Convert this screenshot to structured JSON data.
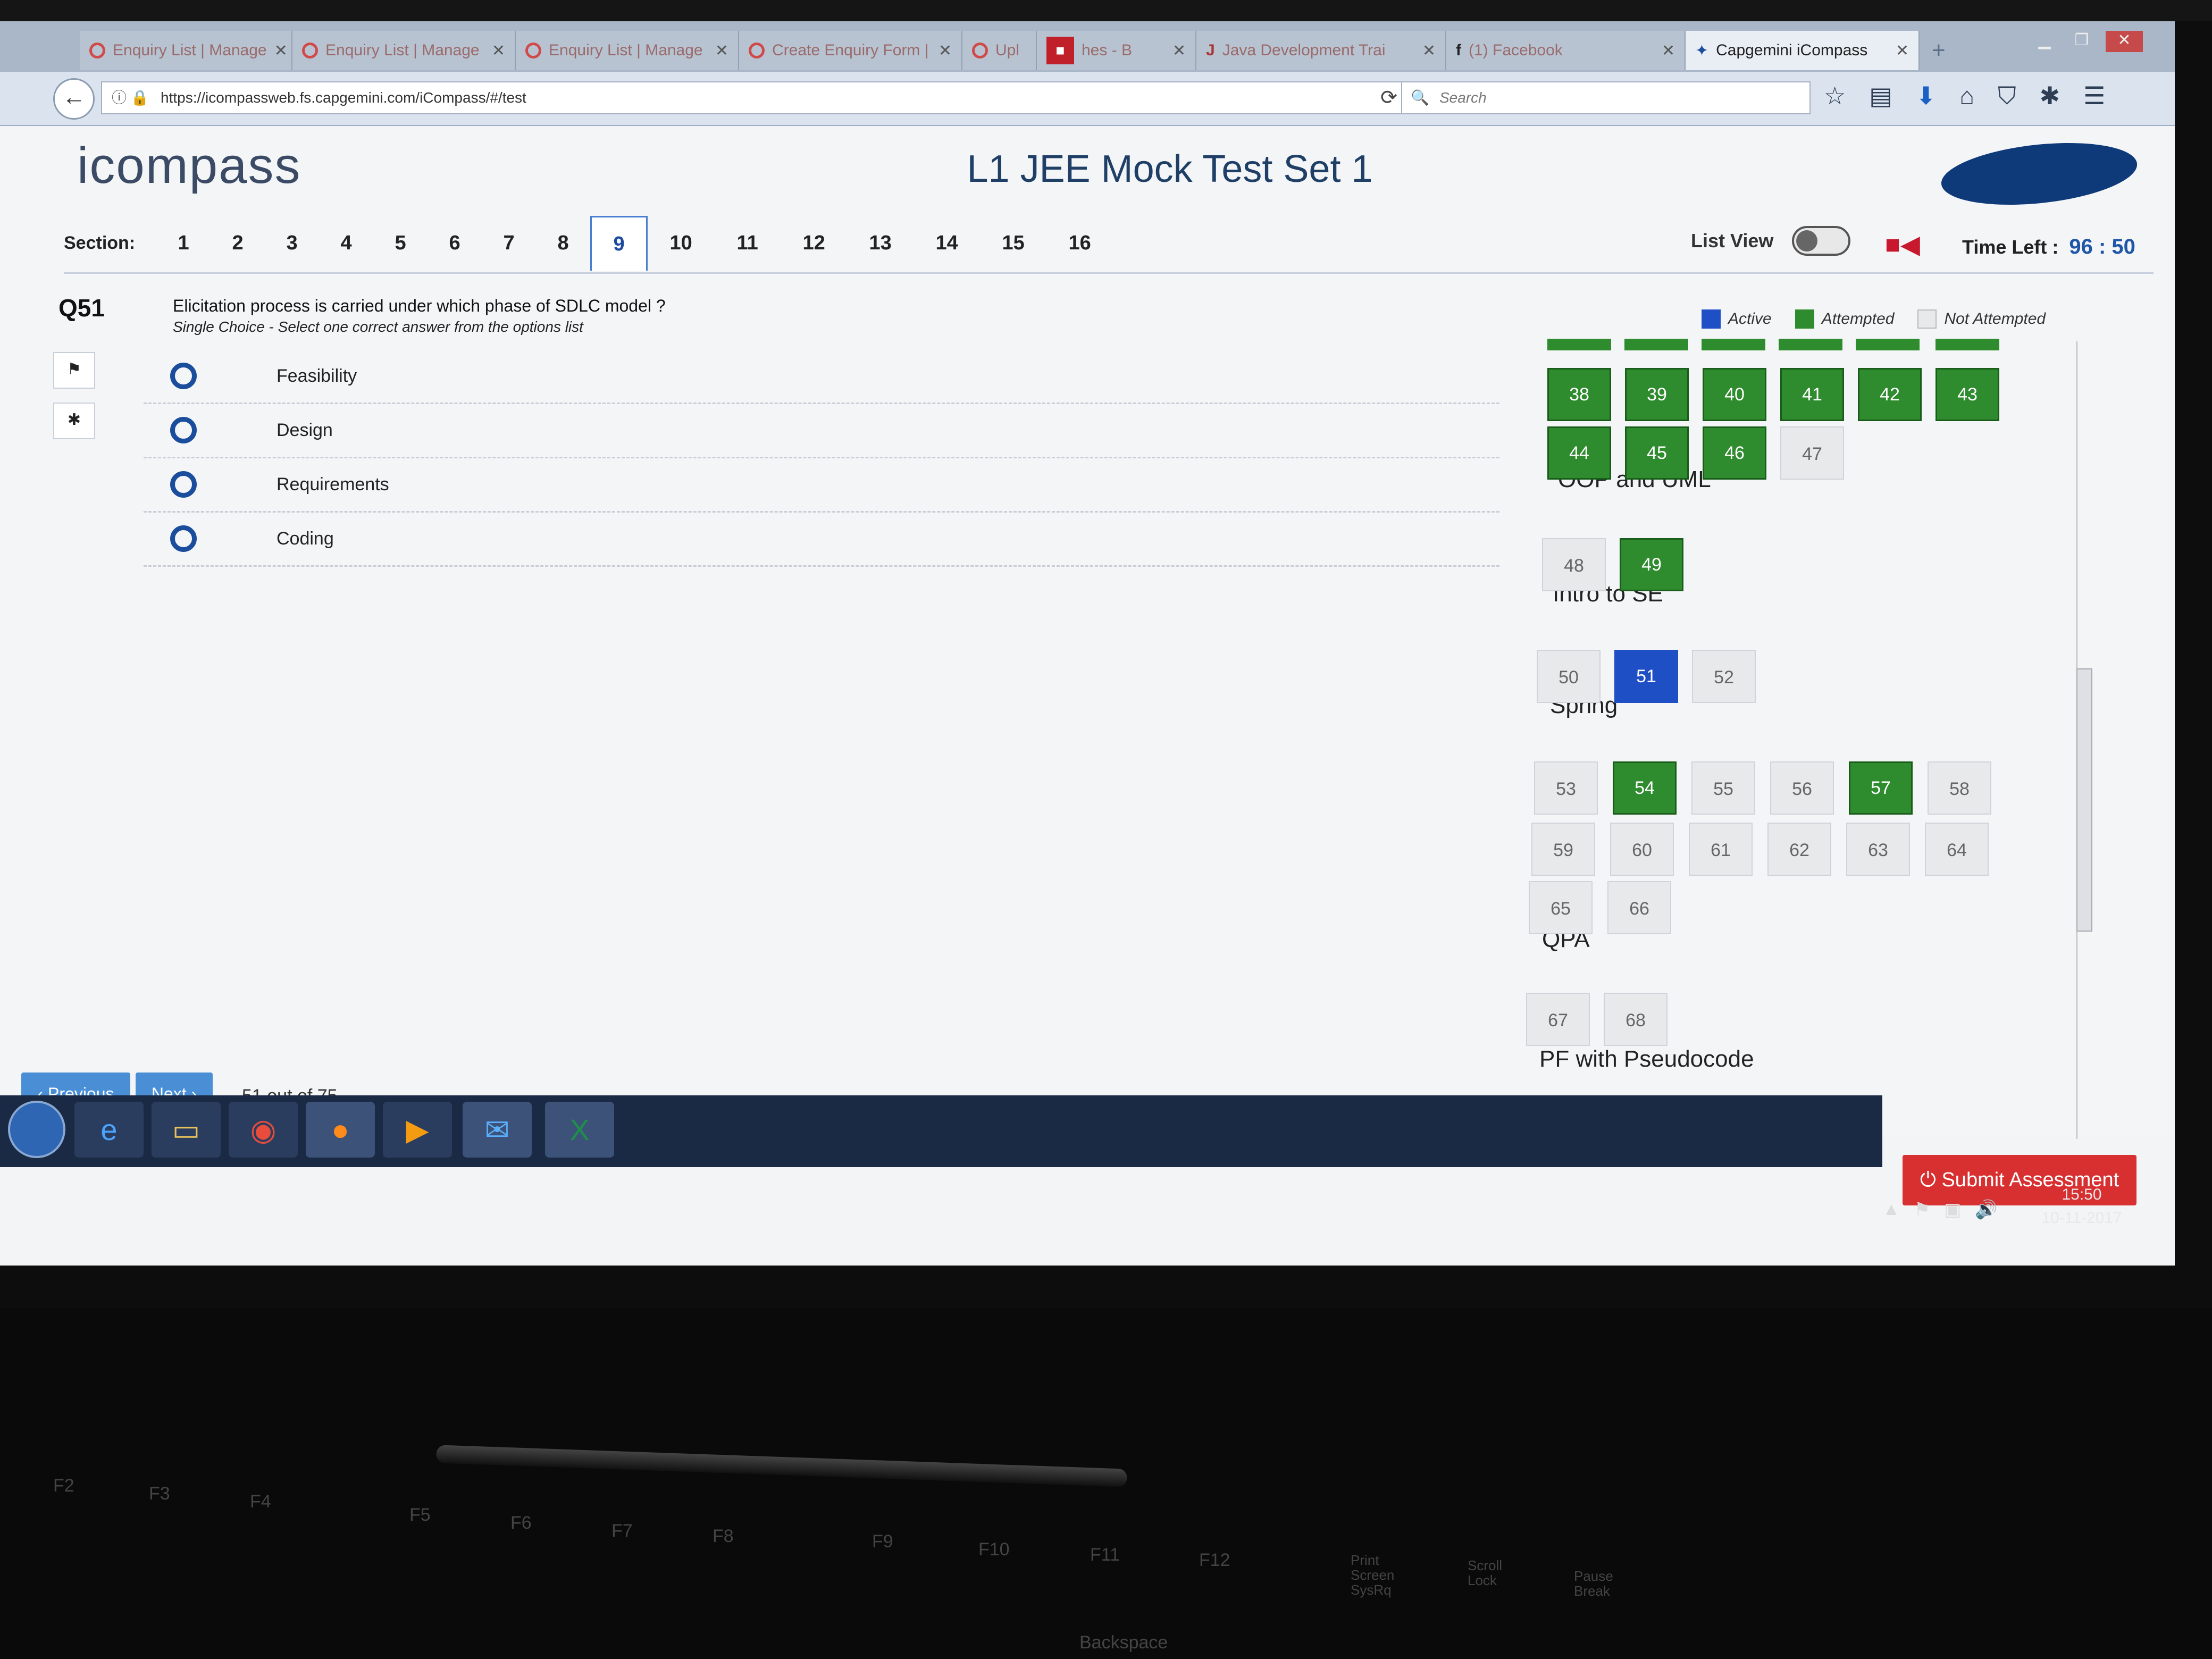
{
  "browser": {
    "tabs": [
      {
        "label": "Enquiry List | Manage"
      },
      {
        "label": "Enquiry List | Manage"
      },
      {
        "label": "Enquiry List | Manage"
      },
      {
        "label": "Create Enquiry Form |"
      },
      {
        "label": "Upl"
      },
      {
        "label": "hes - B"
      },
      {
        "label": "Java Development Trai"
      },
      {
        "label": "(1) Facebook"
      },
      {
        "label": "Capgemini iCompass"
      }
    ],
    "url": "https://icompassweb.fs.capgemini.com/iCompass/#/test",
    "search_placeholder": "Search"
  },
  "page": {
    "logo_text": "icompass",
    "title": "L1 JEE Mock Test Set 1",
    "section_label": "Section:",
    "sections": [
      "1",
      "2",
      "3",
      "4",
      "5",
      "6",
      "7",
      "8",
      "9",
      "10",
      "11",
      "12",
      "13",
      "14",
      "15",
      "16"
    ],
    "active_section": "9",
    "list_view_label": "List View",
    "time_left_label": "Time Left :",
    "time_left_value": "96 : 50"
  },
  "question": {
    "number": "Q51",
    "text": "Elicitation process is carried under which phase of SDLC model ?",
    "hint": "Single Choice - Select one correct answer from the options list",
    "options": [
      "Feasibility",
      "Design",
      "Requirements",
      "Coding"
    ]
  },
  "legend": {
    "active": "Active",
    "attempted": "Attempted",
    "not_attempted": "Not Attempted",
    "colors": {
      "active": "#1f4fc4",
      "attempted": "#2e8b2e",
      "not_attempted": "#e8e9eb"
    }
  },
  "palette": {
    "row1": [
      {
        "n": "38",
        "s": "att"
      },
      {
        "n": "39",
        "s": "att"
      },
      {
        "n": "40",
        "s": "att"
      },
      {
        "n": "41",
        "s": "att"
      },
      {
        "n": "42",
        "s": "att"
      },
      {
        "n": "43",
        "s": "att"
      }
    ],
    "row2": [
      {
        "n": "44",
        "s": "att"
      },
      {
        "n": "45",
        "s": "att"
      },
      {
        "n": "46",
        "s": "att"
      },
      {
        "n": "47",
        "s": "not"
      }
    ],
    "groups": [
      "OOP and UML",
      "Intro to SE",
      "Spring",
      "QPA",
      "PF with Pseudocode"
    ],
    "oop": [
      {
        "n": "48",
        "s": "not"
      },
      {
        "n": "49",
        "s": "att"
      }
    ],
    "intro": [
      {
        "n": "50",
        "s": "not"
      },
      {
        "n": "51",
        "s": "act"
      },
      {
        "n": "52",
        "s": "not"
      }
    ],
    "spring1": [
      {
        "n": "53",
        "s": "not"
      },
      {
        "n": "54",
        "s": "att"
      },
      {
        "n": "55",
        "s": "not"
      },
      {
        "n": "56",
        "s": "not"
      },
      {
        "n": "57",
        "s": "att"
      },
      {
        "n": "58",
        "s": "not"
      }
    ],
    "spring2": [
      {
        "n": "59",
        "s": "not"
      },
      {
        "n": "60",
        "s": "not"
      },
      {
        "n": "61",
        "s": "not"
      },
      {
        "n": "62",
        "s": "not"
      },
      {
        "n": "63",
        "s": "not"
      },
      {
        "n": "64",
        "s": "not"
      }
    ],
    "spring3": [
      {
        "n": "65",
        "s": "not"
      },
      {
        "n": "66",
        "s": "not"
      }
    ],
    "qpa": [
      {
        "n": "67",
        "s": "not"
      },
      {
        "n": "68",
        "s": "not"
      }
    ]
  },
  "footer": {
    "previous": "‹ Previous",
    "next": "Next ›",
    "counter": "51 out of 75",
    "submit": "⏻ Submit Assessment"
  },
  "taskbar": {
    "time": "15:50",
    "date": "10-11-2017"
  },
  "keyboard": {
    "keys": [
      "F2",
      "F3",
      "F4",
      "F5",
      "F6",
      "F7",
      "F8",
      "F9",
      "F10",
      "F11",
      "F12",
      "Print Screen SysRq",
      "Scroll Lock",
      "Pause Break",
      "Backspace"
    ]
  }
}
